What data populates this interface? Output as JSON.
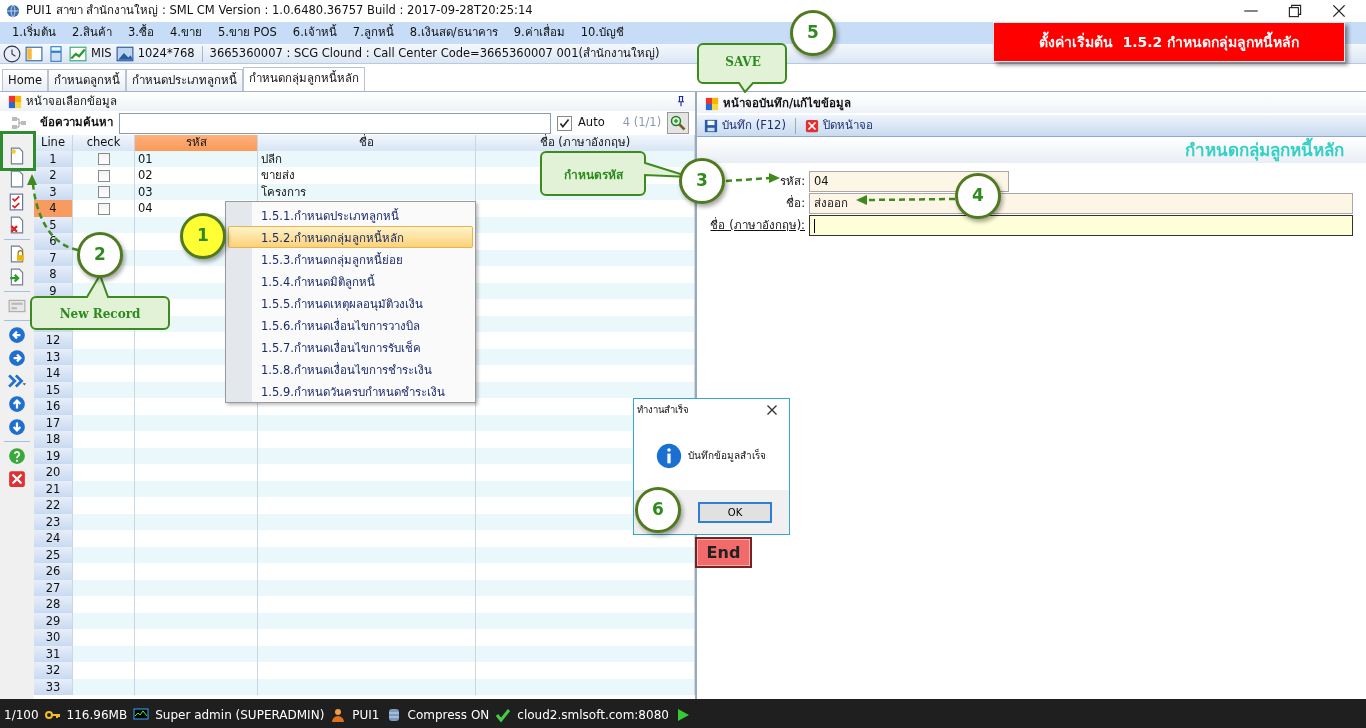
{
  "window": {
    "title": "PUI1 สาขา สำนักงานใหญ่ : SML CM Version : 1.0.6480.36757  Build : 2017-09-28T20:25:14"
  },
  "menu_bar": [
    "1.เริ่มต้น",
    "2.สินค้า",
    "3.ซื้อ",
    "4.ขาย",
    "5.ขาย POS",
    "6.เจ้าหนี้",
    "7.ลูกหนี้",
    "8.เงินสด/ธนาคาร",
    "9.ค่าเสื่อม",
    "10.บัญชี"
  ],
  "toolbar": {
    "mis": "MIS",
    "resolution": "1024*768",
    "info": "3665360007 : SCG Clound : Call Center Code=3665360007 001(สำนักงานใหญ่)"
  },
  "tabs": [
    {
      "label": "Home",
      "selected": false
    },
    {
      "label": "กำหนดลูกหนี้",
      "selected": false
    },
    {
      "label": "กำหนดประเภทลูกหนี้",
      "selected": false
    },
    {
      "label": "กำหนดกลุ่มลูกหนี้หลัก",
      "selected": true
    }
  ],
  "select_panel": {
    "title": "หน้าจอเลือกข้อมูล",
    "search_label": "ข้อความค้นหา",
    "auto": {
      "label": "Auto",
      "checked": true
    },
    "count": "4 (1/1)",
    "columns": [
      {
        "label": "Line",
        "selected": false
      },
      {
        "label": "check",
        "selected": false
      },
      {
        "label": "รหัส",
        "selected": true
      },
      {
        "label": "ชื่อ",
        "selected": false
      },
      {
        "label": "ชื่อ (ภาษาอังกฤษ)",
        "selected": false
      }
    ],
    "rows": [
      {
        "line": "1",
        "checked": false,
        "code": "01",
        "name": "ปลีก",
        "selected": false
      },
      {
        "line": "2",
        "checked": false,
        "code": "02",
        "name": "ขายส่ง",
        "selected": false
      },
      {
        "line": "3",
        "checked": false,
        "code": "03",
        "name": "โครงการ",
        "selected": false
      },
      {
        "line": "4",
        "checked": false,
        "code": "04",
        "selected": true
      },
      {
        "line": "5",
        "selected": false
      },
      {
        "line": "6",
        "selected": false
      },
      {
        "line": "7",
        "selected": false
      },
      {
        "line": "8",
        "selected": false
      },
      {
        "line": "9",
        "selected": false
      },
      {},
      {},
      {
        "line": "12",
        "selected": false
      },
      {
        "line": "13",
        "selected": false
      },
      {
        "line": "14",
        "selected": false
      },
      {
        "line": "15",
        "selected": false
      },
      {
        "line": "16",
        "selected": false
      },
      {
        "line": "17",
        "selected": false
      },
      {
        "line": "18",
        "selected": false
      },
      {
        "line": "19",
        "selected": false
      },
      {
        "line": "20",
        "selected": false
      },
      {
        "line": "21",
        "selected": false
      },
      {
        "line": "22",
        "selected": false
      },
      {
        "line": "23",
        "selected": false
      },
      {
        "line": "24",
        "selected": false
      },
      {
        "line": "25",
        "selected": false
      },
      {
        "line": "26",
        "selected": false
      },
      {
        "line": "27",
        "selected": false
      },
      {
        "line": "28",
        "selected": false
      },
      {
        "line": "29",
        "selected": false
      },
      {
        "line": "30",
        "selected": false
      },
      {
        "line": "31",
        "selected": false
      },
      {
        "line": "32",
        "selected": false
      },
      {
        "line": "33",
        "selected": false
      }
    ]
  },
  "context_menu": [
    {
      "label": "1.5.1.กำหนดประเภทลูกหนี้",
      "selected": false
    },
    {
      "label": "1.5.2.กำหนดกลุ่มลูกหนี้หลัก",
      "selected": true
    },
    {
      "label": "1.5.3.กำหนดกลุ่มลูกหนี้ย่อย",
      "selected": false
    },
    {
      "label": "1.5.4.กำหนดมิติลูกหนี้",
      "selected": false
    },
    {
      "label": "1.5.5.กำหนดเหตุผลอนุมัติวงเงิน",
      "selected": false
    },
    {
      "label": "1.5.6.กำหนดเงื่อนไขการวางบิล",
      "selected": false
    },
    {
      "label": "1.5.7.กำหนดเงื่อนไขการรับเช็ค",
      "selected": false
    },
    {
      "label": "1.5.8.กำหนดเงื่อนไขการชำระเงิน",
      "selected": false
    },
    {
      "label": "1.5.9.กำหนดวันครบกำหนดชำระเงิน",
      "selected": false
    }
  ],
  "edit_panel": {
    "title": "หน้าจอบันทึก/แก้ไขข้อมูล",
    "buttons": [
      {
        "kind": "save",
        "label": "บันทึก (F12)"
      },
      {
        "kind": "close",
        "label": "ปิดหน้าจอ"
      }
    ],
    "heading": "กำหนดกลุ่มลูกหนี้หลัก",
    "fields": [
      {
        "label": "รหัส:",
        "value": "04",
        "focused": false,
        "underlined": false
      },
      {
        "label": "ชื่อ:",
        "value": "ส่งออก",
        "focused": false,
        "underlined": false
      },
      {
        "label": "ชื่อ (ภาษาอังกฤษ):",
        "focused": true,
        "underlined": true
      }
    ]
  },
  "dialog": {
    "title": "ทำงานสำเร็จ",
    "message": "บันทึกข้อมูลสำเร็จ",
    "button": "OK"
  },
  "annotations": {
    "banner": "ตั้งค่าเริ่มต้น  1.5.2 กำหนดกลุ่มลูกหนี้หลัก",
    "steps": [
      {
        "number": "1",
        "color": "#ffff33"
      },
      {
        "number": "2",
        "color": "#ffffff"
      },
      {
        "number": "3",
        "color": "#ffffff"
      },
      {
        "number": "4",
        "color": "#ffffff"
      },
      {
        "number": "5",
        "color": "#ffffff"
      },
      {
        "number": "6",
        "color": "#ffffff"
      }
    ],
    "callouts": [
      "SAVE",
      "New Record",
      "กำหนดรหัส"
    ],
    "end_label": "End"
  },
  "status_bar": [
    "1/100",
    "116.96MB",
    "Super admin (SUPERADMIN)",
    "PUI1",
    "Compress ON",
    "cloud2.smlsoft.com:8080"
  ]
}
